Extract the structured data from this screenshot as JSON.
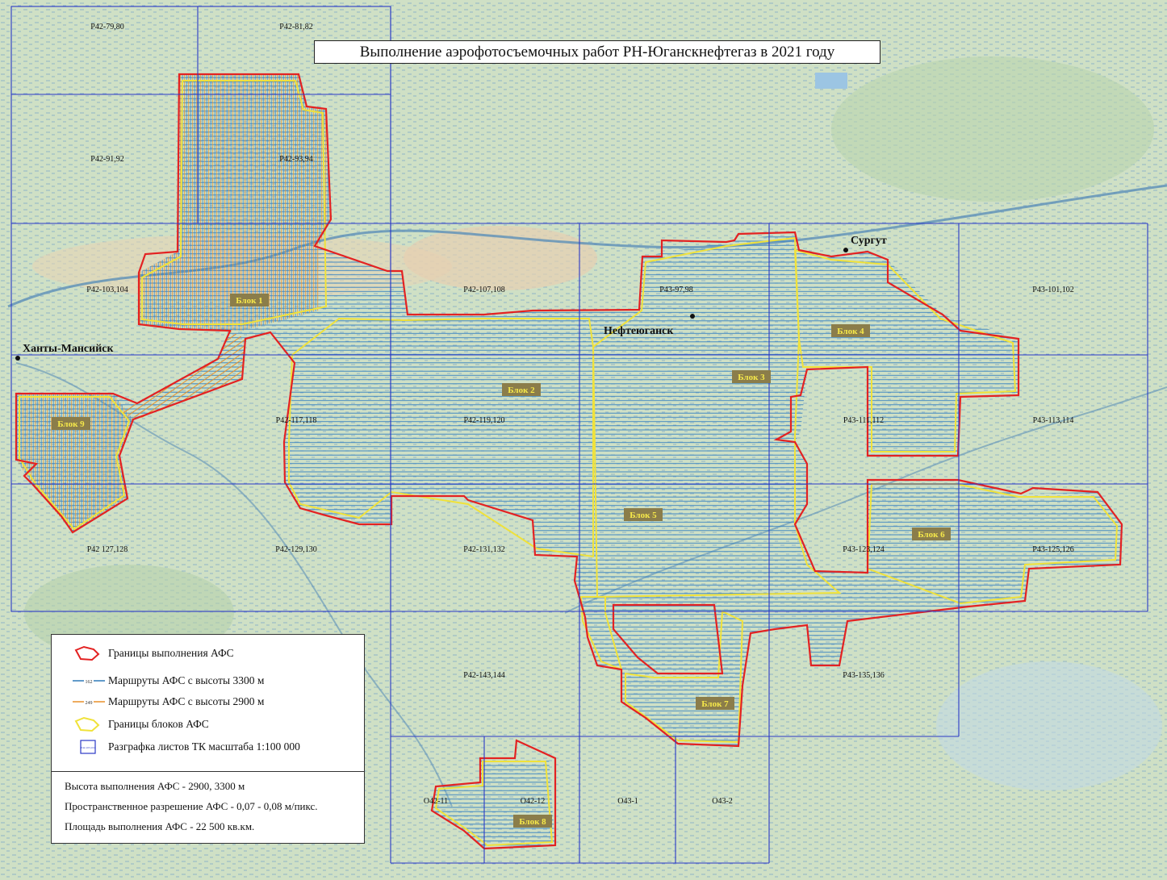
{
  "title": "Выполнение аэрофотосъемочных работ РН-Юганскнефтегаз в 2021 году",
  "cities": [
    {
      "name": "Ханты-Мансийск"
    },
    {
      "name": "Сургут"
    },
    {
      "name": "Нефтеюганск"
    }
  ],
  "sheets": [
    "P42-79,80",
    "P42-81,82",
    "P42-91,92",
    "P42-93,94",
    "P42-103,104",
    "P42-107,108",
    "P43-97,98",
    "P43-101,102",
    "P42-117,118",
    "P42-119,120",
    "P43-111,112",
    "P43-113,114",
    "P42 127,128",
    "P42-129,130",
    "P42-131,132",
    "P43-123,124",
    "P43-125,126",
    "P42-143,144",
    "P43-135,136",
    "O42-11",
    "O42-12",
    "O43-1",
    "O43-2"
  ],
  "blocks": [
    "Блок 1",
    "Блок 2",
    "Блок 3",
    "Блок 4",
    "Блок 5",
    "Блок 6",
    "Блок 7",
    "Блок 8",
    "Блок 9"
  ],
  "legend": {
    "items": [
      {
        "label": "Границы выполнения АФС"
      },
      {
        "label": "Маршруты АФС с высоты 3300 м",
        "tag": "162"
      },
      {
        "label": "Маршруты АФС с высоты 2900 м",
        "tag": "249"
      },
      {
        "label": "Границы блоков АФС"
      },
      {
        "label": "Разграфка листов ТК масштаба 1:100 000",
        "tag": "P42-103,104"
      }
    ]
  },
  "info": {
    "height": "Высота выполнения АФС - 2900, 3300 м",
    "resolution": "Пространственное разрешение АФС - 0,07 - 0,08 м/пикс.",
    "area": "Площадь выполнения АФС - 22 500 кв.км."
  },
  "colors": {
    "boundary": "#e32222",
    "route3300": "#2f7ab8",
    "route2900": "#e8912a",
    "block": "#f0e23a",
    "grid": "#2b39c6",
    "label_bg": "#8b7d4a",
    "label_text": "#f6e94a"
  }
}
